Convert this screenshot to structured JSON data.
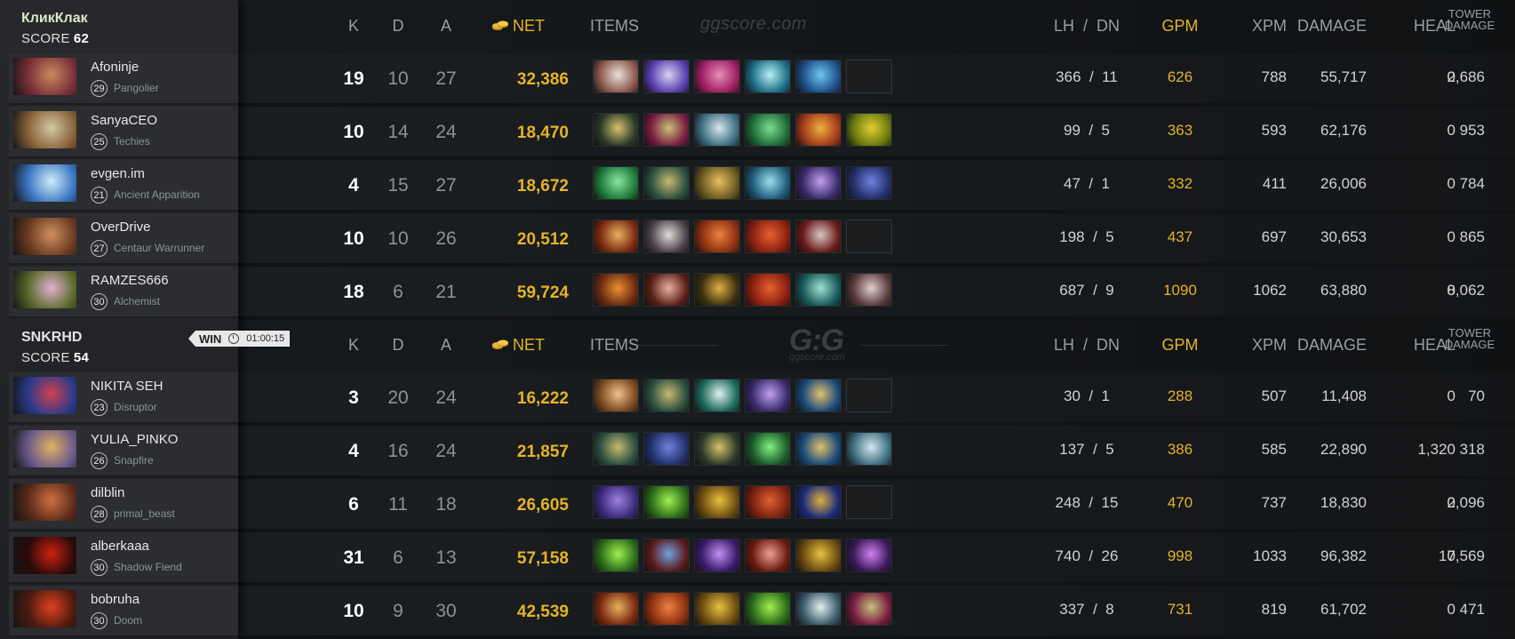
{
  "headers": {
    "k": "K",
    "d": "D",
    "a": "A",
    "net": "NET",
    "items": "ITEMS",
    "lh": "LH",
    "slash": "/",
    "dn": "DN",
    "gpm": "GPM",
    "xpm": "XPM",
    "damage": "DAMAGE",
    "heal": "HEAL",
    "tower1": "TOWER",
    "tower2": "DAMAGE"
  },
  "watermark_top": "ggscore.com",
  "watermark_logo": "G:G",
  "watermark_logo_sub": "ggscore.com",
  "result": {
    "label": "WIN",
    "time": "01:00:15",
    "icon": "clock-icon"
  },
  "colors": {
    "gold": "#e4b328",
    "kills": "#ffffff",
    "muted": "#8e9195"
  },
  "teams": [
    {
      "name": "КликКлак",
      "score_label": "SCORE",
      "score": "62",
      "players": [
        {
          "name": "Afoninje",
          "level": "29",
          "hero": "Pangolier",
          "k": "19",
          "d": "10",
          "a": "27",
          "net": "32,386",
          "lh": "366",
          "dn": "11",
          "gpm": "626",
          "xpm": "788",
          "damage": "55,717",
          "heal": "0",
          "tower": "2,686",
          "portrait": [
            "#7a2f3a",
            "#c98a5a"
          ],
          "items": [
            [
              "#8d5a4c",
              "#e7e2dc"
            ],
            [
              "#5a3fb0",
              "#d7d2f0"
            ],
            [
              "#a01e63",
              "#e48fb7"
            ],
            [
              "#1d6f88",
              "#b8eef5"
            ],
            [
              "#1d4f8b",
              "#6fc8ee"
            ],
            null
          ]
        },
        {
          "name": "SanyaCEO",
          "level": "25",
          "hero": "Techies",
          "k": "10",
          "d": "14",
          "a": "24",
          "net": "18,470",
          "lh": "99",
          "dn": "5",
          "gpm": "363",
          "xpm": "593",
          "damage": "62,176",
          "heal": "0",
          "tower": "953",
          "portrait": [
            "#8a6237",
            "#cfc9a6"
          ],
          "items": [
            [
              "#2a3a2a",
              "#d5c26a"
            ],
            [
              "#7a1d40",
              "#c6c07a"
            ],
            [
              "#3d6f80",
              "#d6e7ee"
            ],
            [
              "#1f6a3a",
              "#7be08a"
            ],
            [
              "#a33a1a",
              "#f0b040"
            ],
            [
              "#6a7a10",
              "#e0d030"
            ]
          ]
        },
        {
          "name": "evgen.im",
          "level": "21",
          "hero": "Ancient Apparition",
          "k": "4",
          "d": "15",
          "a": "27",
          "net": "18,672",
          "lh": "47",
          "dn": "1",
          "gpm": "332",
          "xpm": "411",
          "damage": "26,006",
          "heal": "0",
          "tower": "784",
          "portrait": [
            "#3a74c2",
            "#d0eef8"
          ],
          "items": [
            [
              "#1d7a3a",
              "#8ae6a0"
            ],
            [
              "#2a5040",
              "#c8b870"
            ],
            [
              "#6a5a20",
              "#e8c060"
            ],
            [
              "#1f5a7a",
              "#9ae0f0"
            ],
            [
              "#3a2a6a",
              "#c0a0f0"
            ],
            [
              "#23306a",
              "#7080e0"
            ]
          ]
        },
        {
          "name": "OverDrive",
          "level": "27",
          "hero": "Centaur Warrunner",
          "k": "10",
          "d": "10",
          "a": "26",
          "net": "20,512",
          "lh": "198",
          "dn": "5",
          "gpm": "437",
          "xpm": "697",
          "damage": "30,653",
          "heal": "0",
          "tower": "865",
          "portrait": [
            "#6a3a20",
            "#d09060"
          ],
          "items": [
            [
              "#7a2a10",
              "#e8b060"
            ],
            [
              "#4a4048",
              "#e0dcd8"
            ],
            [
              "#8a3010",
              "#f08040"
            ],
            [
              "#8a2010",
              "#e86030"
            ],
            [
              "#6a1a1a",
              "#d8c8c8"
            ],
            null
          ]
        },
        {
          "name": "RAMZES666",
          "level": "30",
          "hero": "Alchemist",
          "k": "18",
          "d": "6",
          "a": "21",
          "net": "59,724",
          "lh": "687",
          "dn": "9",
          "gpm": "1090",
          "xpm": "1062",
          "damage": "63,880",
          "heal": "0",
          "tower": "8,062",
          "portrait": [
            "#5a6a2a",
            "#e0b0d0"
          ],
          "items": [
            [
              "#6a2a10",
              "#e89030"
            ],
            [
              "#5a2018",
              "#e8b0a0"
            ],
            [
              "#3a3010",
              "#e0b040"
            ],
            [
              "#8a2010",
              "#e86030"
            ],
            [
              "#1a5a5a",
              "#a0e0d0"
            ],
            [
              "#5a3a3a",
              "#e0d0d0"
            ]
          ]
        }
      ]
    },
    {
      "name": "SNKRHD",
      "score_label": "SCORE",
      "score": "54",
      "players": [
        {
          "name": "NIKITA SEH",
          "level": "23",
          "hero": "Disruptor",
          "k": "3",
          "d": "20",
          "a": "24",
          "net": "16,222",
          "lh": "30",
          "dn": "1",
          "gpm": "288",
          "xpm": "507",
          "damage": "11,408",
          "heal": "0",
          "tower": "70",
          "portrait": [
            "#2a3a8a",
            "#d04050"
          ],
          "items": [
            [
              "#7a4a20",
              "#f0c090"
            ],
            [
              "#2a5040",
              "#c8b870"
            ],
            [
              "#1a6a5a",
              "#e0f0f0"
            ],
            [
              "#3a2a6a",
              "#c0a0f0"
            ],
            [
              "#1a4a7a",
              "#e0c070"
            ],
            null
          ]
        },
        {
          "name": "YULIA_PINKO",
          "level": "26",
          "hero": "Snapfire",
          "k": "4",
          "d": "16",
          "a": "24",
          "net": "21,857",
          "lh": "137",
          "dn": "5",
          "gpm": "386",
          "xpm": "585",
          "damage": "22,890",
          "heal": "1,320",
          "tower": "318",
          "portrait": [
            "#6a5a8a",
            "#e0b060"
          ],
          "items": [
            [
              "#2a5040",
              "#c8b870"
            ],
            [
              "#23306a",
              "#7080e0"
            ],
            [
              "#2a3a2a",
              "#d5c26a"
            ],
            [
              "#1a5a2a",
              "#80f080"
            ],
            [
              "#1a4a7a",
              "#e0c070"
            ],
            [
              "#3d6f80",
              "#d6e7ee"
            ]
          ]
        },
        {
          "name": "dilblin",
          "level": "28",
          "hero": "primal_beast",
          "k": "6",
          "d": "11",
          "a": "18",
          "net": "26,605",
          "lh": "248",
          "dn": "15",
          "gpm": "470",
          "xpm": "737",
          "damage": "18,830",
          "heal": "0",
          "tower": "2,096",
          "portrait": [
            "#5a2a1a",
            "#d07040"
          ],
          "items": [
            [
              "#3a2a7a",
              "#a080e0"
            ],
            [
              "#2a6a1a",
              "#a0f050"
            ],
            [
              "#6a4a10",
              "#e8c040"
            ],
            [
              "#7a2010",
              "#e06030"
            ],
            [
              "#1a2a7a",
              "#e0b040"
            ],
            null
          ]
        },
        {
          "name": "alberkaaa",
          "level": "30",
          "hero": "Shadow Fiend",
          "k": "31",
          "d": "6",
          "a": "13",
          "net": "57,158",
          "lh": "740",
          "dn": "26",
          "gpm": "998",
          "xpm": "1033",
          "damage": "96,382",
          "heal": "0",
          "tower": "17,569",
          "portrait": [
            "#2a0a0a",
            "#d02010"
          ],
          "items": [
            [
              "#2a6a1a",
              "#a0f050"
            ],
            [
              "#5a1a1a",
              "#70a0e0"
            ],
            [
              "#3a1a6a",
              "#c090f0"
            ],
            [
              "#6a1a10",
              "#f0a090"
            ],
            [
              "#6a4a10",
              "#e8c040"
            ],
            [
              "#3a1a5a",
              "#d080f0"
            ]
          ]
        },
        {
          "name": "bobruha",
          "level": "30",
          "hero": "Doom",
          "k": "10",
          "d": "9",
          "a": "30",
          "net": "42,539",
          "lh": "337",
          "dn": "8",
          "gpm": "731",
          "xpm": "819",
          "damage": "61,702",
          "heal": "0",
          "tower": "471",
          "portrait": [
            "#4a1a10",
            "#e04020"
          ],
          "items": [
            [
              "#7a2a10",
              "#e8b060"
            ],
            [
              "#8a3010",
              "#f08040"
            ],
            [
              "#6a4a10",
              "#e8c040"
            ],
            [
              "#2a6a1a",
              "#a0f050"
            ],
            [
              "#3a5a6a",
              "#e0f0f0"
            ],
            [
              "#7a1d40",
              "#c6c07a"
            ]
          ]
        }
      ]
    }
  ]
}
